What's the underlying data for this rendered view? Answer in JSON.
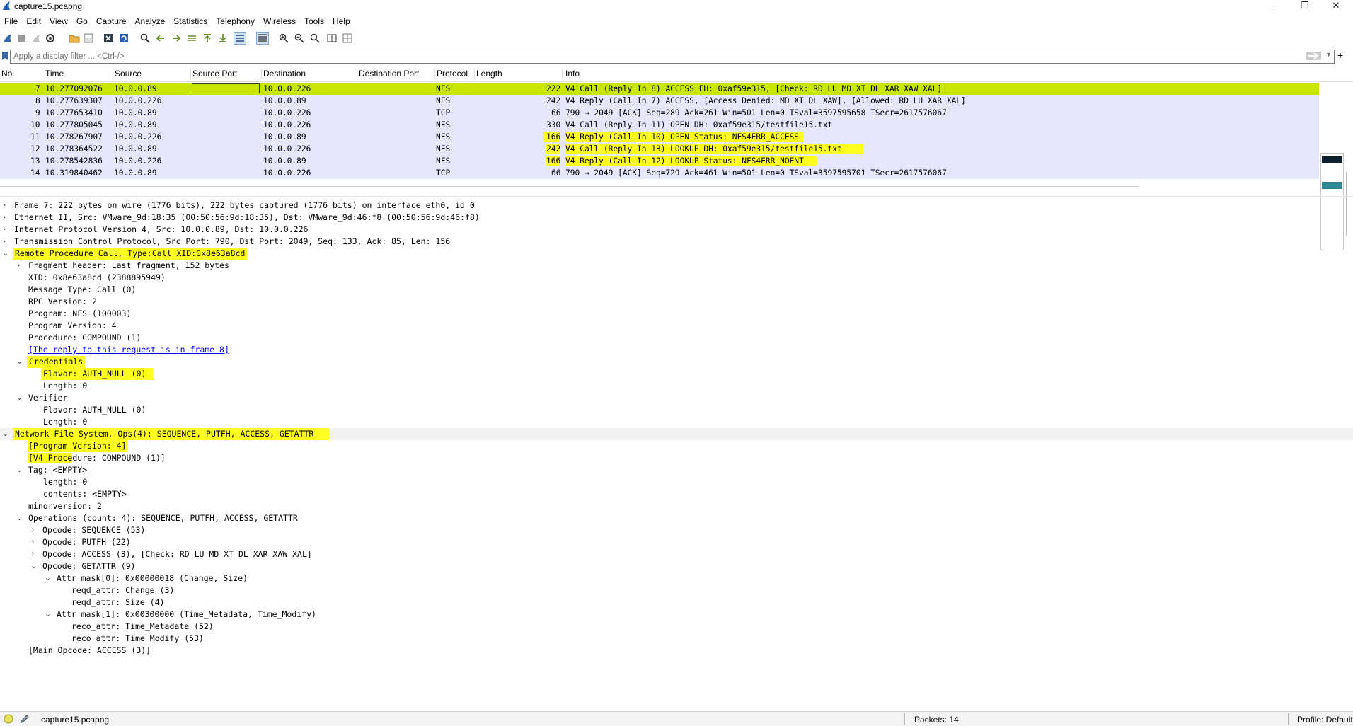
{
  "window": {
    "title": "capture15.pcapng",
    "minimize": "–",
    "maximize": "❐",
    "close": "✕"
  },
  "menu": [
    "File",
    "Edit",
    "View",
    "Go",
    "Capture",
    "Analyze",
    "Statistics",
    "Telephony",
    "Wireless",
    "Tools",
    "Help"
  ],
  "filter": {
    "placeholder": "Apply a display filter ... <Ctrl-/>",
    "value": ""
  },
  "columns": [
    "No.",
    "Time",
    "Source",
    "Source Port",
    "Destination",
    "Destination Port",
    "Protocol",
    "Length",
    "Info"
  ],
  "packets": [
    {
      "no": "7",
      "time": "10.277092076",
      "src": "10.0.0.89",
      "dst": "10.0.0.226",
      "proto": "NFS",
      "len": "222",
      "info": "V4 Call (Reply In 8) ACCESS FH: 0xaf59e315, [Check: RD LU MD XT DL XAR XAW XAL]",
      "selected": true
    },
    {
      "no": "8",
      "time": "10.277639307",
      "src": "10.0.0.226",
      "dst": "10.0.0.89",
      "proto": "NFS",
      "len": "242",
      "info": "V4 Reply (Call In 7) ACCESS, [Access Denied: MD XT DL XAW], [Allowed: RD LU XAR XAL]",
      "selected": false
    },
    {
      "no": "9",
      "time": "10.277653410",
      "src": "10.0.0.89",
      "dst": "10.0.0.226",
      "proto": "TCP",
      "len": "66",
      "info": "790 → 2049 [ACK] Seq=289 Ack=261 Win=501 Len=0 TSval=3597595658 TSecr=2617576067",
      "selected": false
    },
    {
      "no": "10",
      "time": "10.277805045",
      "src": "10.0.0.89",
      "dst": "10.0.0.226",
      "proto": "NFS",
      "len": "330",
      "info": "V4 Call (Reply In 11) OPEN DH: 0xaf59e315/testfile15.txt",
      "selected": false
    },
    {
      "no": "11",
      "time": "10.278267907",
      "src": "10.0.0.226",
      "dst": "10.0.0.89",
      "proto": "NFS",
      "len": "166",
      "info": "V4 Reply (Call In 10) OPEN Status: NFS4ERR_ACCESS",
      "selected": false
    },
    {
      "no": "12",
      "time": "10.278364522",
      "src": "10.0.0.89",
      "dst": "10.0.0.226",
      "proto": "NFS",
      "len": "242",
      "info": "V4 Call (Reply In 13) LOOKUP DH: 0xaf59e315/testfile15.txt",
      "selected": false
    },
    {
      "no": "13",
      "time": "10.278542836",
      "src": "10.0.0.226",
      "dst": "10.0.0.89",
      "proto": "NFS",
      "len": "166",
      "info": "V4 Reply (Call In 12) LOOKUP Status: NFS4ERR_NOENT",
      "selected": false
    },
    {
      "no": "14",
      "time": "10.319840462",
      "src": "10.0.0.89",
      "dst": "10.0.0.226",
      "proto": "TCP",
      "len": "66",
      "info": "790 → 2049 [ACK] Seq=729 Ack=461 Win=501 Len=0 TSval=3597595701 TSecr=2617576067",
      "selected": false
    }
  ],
  "details": {
    "frame": "Frame 7: 222 bytes on wire (1776 bits), 222 bytes captured (1776 bits) on interface eth0, id 0",
    "ethernet": "Ethernet II, Src: VMware_9d:18:35 (00:50:56:9d:18:35), Dst: VMware_9d:46:f8 (00:50:56:9d:46:f8)",
    "ip": "Internet Protocol Version 4, Src: 10.0.0.89, Dst: 10.0.0.226",
    "tcp": "Transmission Control Protocol, Src Port: 790, Dst Port: 2049, Seq: 133, Ack: 85, Len: 156",
    "rpc": "Remote Procedure Call, Type:Call XID:0x8e63a8cd",
    "fragment": "Fragment header: Last fragment, 152 bytes",
    "xid": "XID: 0x8e63a8cd (2388895949)",
    "msgtype": "Message Type: Call (0)",
    "rpcver": "RPC Version: 2",
    "program": "Program: NFS (100003)",
    "progver": "Program Version: 4",
    "procedure": "Procedure: COMPOUND (1)",
    "replylink": "[The reply to this request is in frame 8]",
    "credentials": "Credentials",
    "cred_flavor": "Flavor: AUTH_NULL (0)",
    "cred_length": "Length: 0",
    "verifier": "Verifier",
    "ver_flavor": "Flavor: AUTH_NULL (0)",
    "ver_length": "Length: 0",
    "nfs": "Network File System, Ops(4): SEQUENCE, PUTFH, ACCESS, GETATTR",
    "nfs_progver": "[Program Version: 4]",
    "v4proc_a": "[V4 Proce",
    "v4proc_b": "dure: COMPOUND (1)]",
    "tag": "Tag: <EMPTY>",
    "tag_length": "length: 0",
    "tag_contents": "contents: <EMPTY>",
    "minorversion": "minorversion: 2",
    "operations": "Operations (count: 4): SEQUENCE, PUTFH, ACCESS, GETATTR",
    "op1": "Opcode: SEQUENCE (53)",
    "op2": "Opcode: PUTFH (22)",
    "op3": "Opcode: ACCESS (3), [Check: RD LU MD XT DL XAR XAW XAL]",
    "op4": "Opcode: GETATTR (9)",
    "attr0": "Attr mask[0]: 0x00000018 (Change, Size)",
    "reqd1": "reqd_attr: Change (3)",
    "reqd2": "reqd_attr: Size (4)",
    "attr1": "Attr mask[1]: 0x00300000 (Time_Metadata, Time_Modify)",
    "reco1": "reco_attr: Time_Metadata (52)",
    "reco2": "reco_attr: Time_Modify (53)",
    "mainop": "[Main Opcode: ACCESS (3)]"
  },
  "status": {
    "file": "capture15.pcapng",
    "packets": "Packets: 14",
    "profile": "Profile: Default"
  },
  "colors": {
    "selected_row": "#c7e600",
    "row_bg": "#e7e6ff",
    "highlight": "#ffff20"
  }
}
